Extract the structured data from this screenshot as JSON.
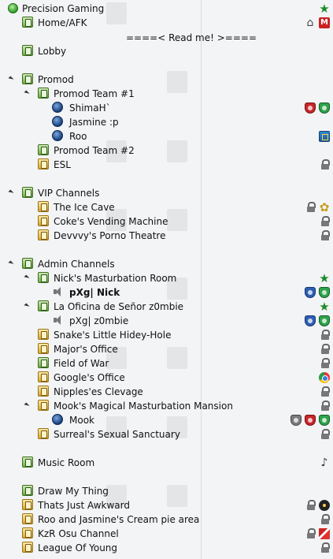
{
  "server": {
    "name": "Precision Gaming"
  },
  "channels": [
    {
      "label": "Home/AFK",
      "kind": "chan",
      "icons": [
        "home-icon",
        "m-badge-icon"
      ]
    },
    {
      "label": "Lobby",
      "kind": "chan"
    },
    {
      "label": "Promod",
      "kind": "chan",
      "expanded": true
    },
    {
      "label": "Promod Team #1",
      "kind": "chan",
      "expanded": true
    },
    {
      "label": "ShimaH`",
      "kind": "user",
      "icons": [
        "red-shield-icon",
        "green-shield-icon"
      ]
    },
    {
      "label": "Jasmine :p",
      "kind": "user"
    },
    {
      "label": "Roo",
      "kind": "user",
      "icons": [
        "tile-icon"
      ]
    },
    {
      "label": "Promod Team #2",
      "kind": "chan"
    },
    {
      "label": "ESL",
      "kind": "lock",
      "icons": [
        "padlock-icon"
      ]
    },
    {
      "label": "VIP Channels",
      "kind": "chan",
      "expanded": true
    },
    {
      "label": "The Ice Cave",
      "kind": "lock",
      "icons": [
        "padlock-icon",
        "flower-icon"
      ]
    },
    {
      "label": "Coke's Vending Machine",
      "kind": "lock",
      "icons": [
        "padlock-icon"
      ]
    },
    {
      "label": "Devvvy's Porno Theatre",
      "kind": "lock",
      "icons": [
        "padlock-icon"
      ]
    },
    {
      "label": "Admin Channels",
      "kind": "chan",
      "expanded": true
    },
    {
      "label": "Nick's Masturbation Room",
      "kind": "chan",
      "expanded": true,
      "icons": [
        "star-icon"
      ]
    },
    {
      "label": "pXg| Nick",
      "kind": "spk",
      "bold": true,
      "icons": [
        "blue-shield-icon",
        "green-shield-icon"
      ]
    },
    {
      "label": "La Oficina de Señor z0mbie",
      "kind": "chan",
      "expanded": true,
      "icons": [
        "star-icon"
      ]
    },
    {
      "label": "pXg| z0mbie",
      "kind": "spk",
      "icons": [
        "blue-shield-icon",
        "green-shield-icon"
      ]
    },
    {
      "label": "Snake's Little Hidey-Hole",
      "kind": "lock",
      "icons": [
        "padlock-icon"
      ]
    },
    {
      "label": "Major's Office",
      "kind": "lock",
      "icons": [
        "padlock-icon"
      ]
    },
    {
      "label": "Field of War",
      "kind": "chan",
      "icons": [
        "padlock-icon"
      ]
    },
    {
      "label": "Google's Office",
      "kind": "lock",
      "icons": [
        "chrome-icon"
      ]
    },
    {
      "label": "Nipples'es Clevage",
      "kind": "lock",
      "icons": [
        "padlock-icon"
      ]
    },
    {
      "label": "Mook's Magical Masturbation Mansion",
      "kind": "lock",
      "expanded": true,
      "icons": [
        "padlock-icon"
      ]
    },
    {
      "label": "Mook",
      "kind": "user",
      "icons": [
        "grey-shield-icon",
        "red-shield-icon",
        "green-shield-icon"
      ]
    },
    {
      "label": "Surreal's Sexual Sanctuary",
      "kind": "lock",
      "icons": [
        "padlock-icon"
      ]
    },
    {
      "label": "Music Room",
      "kind": "chan",
      "icons": [
        "music-note-icon"
      ]
    },
    {
      "label": "Draw My Thing",
      "kind": "chan"
    },
    {
      "label": "Thats Just Awkward",
      "kind": "lock",
      "icons": [
        "padlock-icon",
        "bomb-icon"
      ]
    },
    {
      "label": "Roo and Jasmine's Cream pie area",
      "kind": "lock",
      "icons": [
        "padlock-icon"
      ]
    },
    {
      "label": "KzR Osu Channel",
      "kind": "lock",
      "icons": [
        "padlock-icon",
        "flag-icon"
      ]
    },
    {
      "label": "League Of Young",
      "kind": "lock",
      "icons": [
        "padlock-icon"
      ]
    }
  ],
  "motd": "====< Read me! >====",
  "colors": {
    "selection": "#c9dff8",
    "background": "#f3f4f6",
    "channel": "#6fae3e",
    "locked_channel": "#d8a733",
    "user": "#173e7a"
  }
}
